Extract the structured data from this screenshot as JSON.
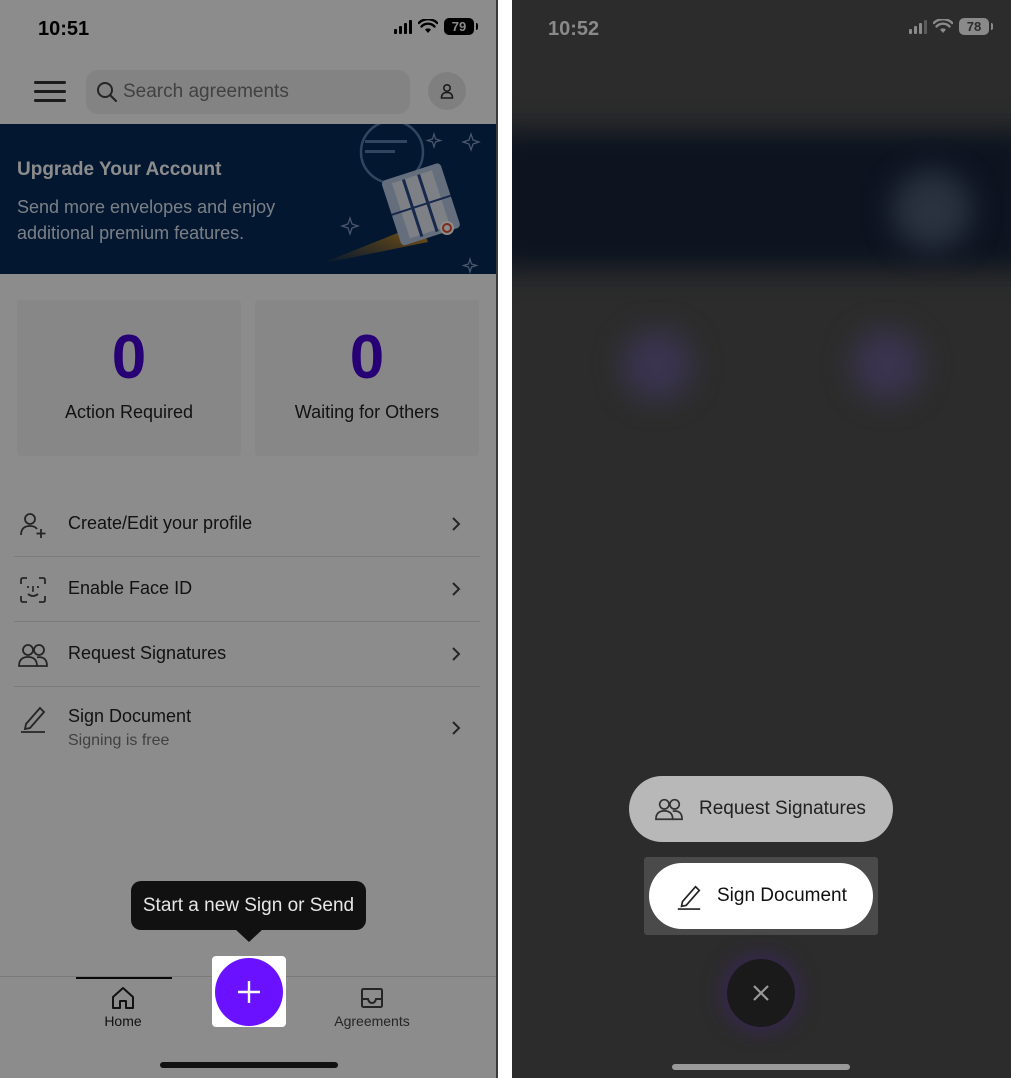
{
  "left": {
    "status": {
      "time": "10:51",
      "battery": "79"
    },
    "search": {
      "placeholder": "Search agreements"
    },
    "banner": {
      "title": "Upgrade Your Account",
      "subtitle": "Send more envelopes and enjoy additional premium features."
    },
    "stats": [
      {
        "value": "0",
        "label": "Action Required"
      },
      {
        "value": "0",
        "label": "Waiting for Others"
      }
    ],
    "menu": [
      {
        "label": "Create/Edit your profile",
        "icon": "profile-add-icon"
      },
      {
        "label": "Enable Face ID",
        "icon": "face-id-icon"
      },
      {
        "label": "Request Signatures",
        "icon": "people-icon"
      },
      {
        "label": "Sign Document",
        "sublabel": "Signing is free",
        "icon": "pen-icon"
      }
    ],
    "tooltip": "Start a new Sign or Send",
    "tabs": [
      {
        "label": "Home",
        "icon": "home-icon",
        "active": true
      },
      {
        "label": "Agreements",
        "icon": "inbox-icon",
        "active": false
      }
    ]
  },
  "right": {
    "status": {
      "time": "10:52",
      "battery": "78"
    },
    "actions": [
      {
        "label": "Request Signatures",
        "icon": "people-icon"
      },
      {
        "label": "Sign Document",
        "icon": "pen-icon",
        "highlighted": true
      }
    ]
  },
  "colors": {
    "accent": "#6a12ff",
    "stat_number": "#4a00d6",
    "banner_bg": "#062a5a"
  }
}
